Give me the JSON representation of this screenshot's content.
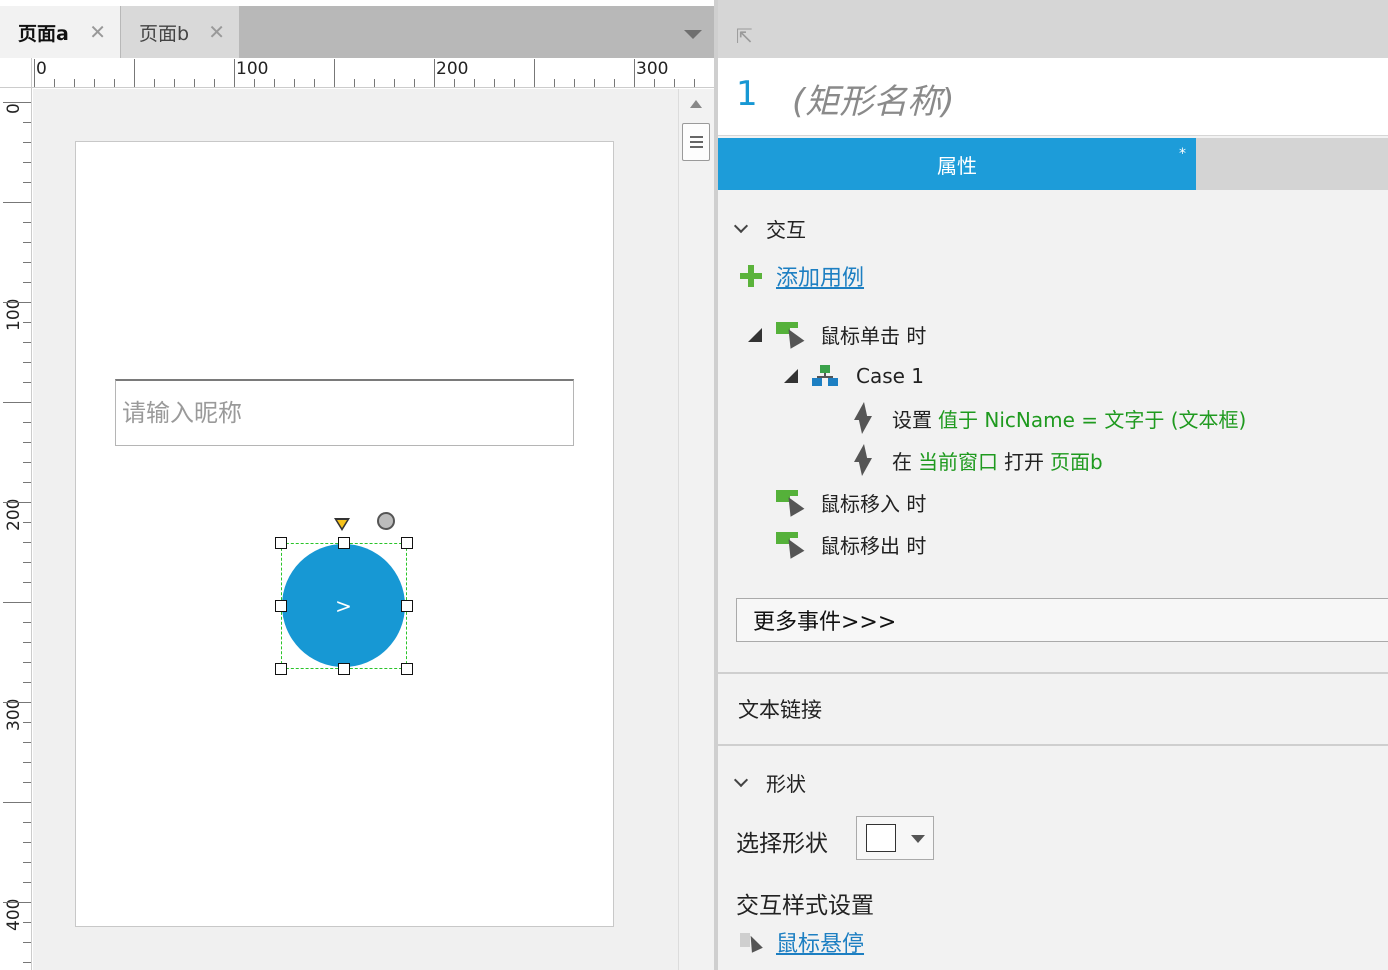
{
  "editor": {
    "tabs": [
      {
        "label": "页面a",
        "close": "✕"
      },
      {
        "label": "页面b",
        "close": "✕"
      }
    ],
    "ruler": {
      "horizontal": [
        "0",
        "100",
        "200",
        "300"
      ],
      "vertical": [
        "0",
        "100",
        "200",
        "300",
        "400"
      ]
    },
    "canvas": {
      "textbox_placeholder": "请输入昵称",
      "circle_label": ">"
    }
  },
  "panel": {
    "shape_number": "1",
    "shape_name": "(矩形名称)",
    "tab_properties": "属性",
    "tab_marker": "*",
    "interaction": {
      "title": "交互",
      "add_case": "添加用例",
      "events": {
        "click": "鼠标单击 时",
        "case_name": "Case 1",
        "action1": {
          "verb": "设置",
          "detail": "值于 NicName = 文字于 (文本框)"
        },
        "action2": {
          "verb1": "在",
          "target": "当前窗口",
          "verb2": "打开",
          "page": "页面b"
        },
        "mouse_enter": "鼠标移入 时",
        "mouse_leave": "鼠标移出 时"
      },
      "more_events": "更多事件>>>"
    },
    "text_link": "文本链接",
    "shape": {
      "title": "形状",
      "select_shape_label": "选择形状",
      "interaction_style_label": "交互样式设置",
      "hover_link": "鼠标悬停"
    }
  },
  "colors": {
    "accent": "#1d9cd9",
    "circle": "#1798d4",
    "selection": "#29c429",
    "action_text": "#1f9a1f",
    "link": "#1d7fc2"
  }
}
